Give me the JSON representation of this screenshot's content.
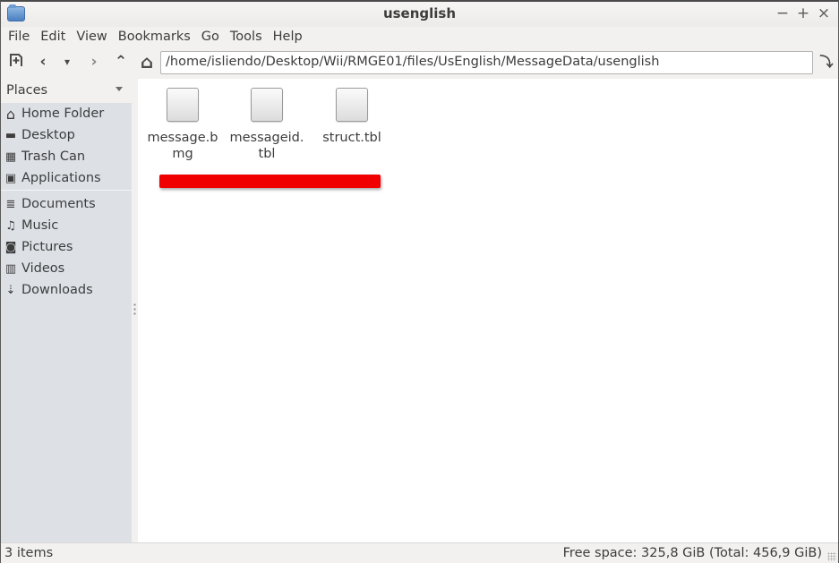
{
  "window": {
    "title": "usenglish",
    "controls": {
      "minimize": "−",
      "maximize": "+",
      "close": "×"
    }
  },
  "menubar": {
    "items": [
      "File",
      "Edit",
      "View",
      "Bookmarks",
      "Go",
      "Tools",
      "Help"
    ]
  },
  "toolbar": {
    "new_tab_icon": "new-tab-icon",
    "back_icon": "‹",
    "history_icon": "▾",
    "forward_icon": "›",
    "up_icon": "⌃",
    "home_icon": "⌂",
    "address": "/home/isliendo/Desktop/Wii/RMGE01/files/UsEnglish/MessageData/usenglish",
    "go_icon": "⤵"
  },
  "sidebar": {
    "header": "Places",
    "items": [
      {
        "label": "Home Folder",
        "icon": "home-icon",
        "glyph": "⌂"
      },
      {
        "label": "Desktop",
        "icon": "desktop-icon",
        "glyph": "▬"
      },
      {
        "label": "Trash Can",
        "icon": "trash-icon",
        "glyph": "▦"
      },
      {
        "label": "Applications",
        "icon": "applications-icon",
        "glyph": "▣"
      },
      {
        "label": "Documents",
        "icon": "documents-icon",
        "glyph": "≣"
      },
      {
        "label": "Music",
        "icon": "music-icon",
        "glyph": "♫"
      },
      {
        "label": "Pictures",
        "icon": "pictures-icon",
        "glyph": "◙"
      },
      {
        "label": "Videos",
        "icon": "videos-icon",
        "glyph": "▥"
      },
      {
        "label": "Downloads",
        "icon": "downloads-icon",
        "glyph": "⇣"
      }
    ]
  },
  "files": [
    {
      "name": "message.bmg"
    },
    {
      "name": "messageid.tbl"
    },
    {
      "name": "struct.tbl"
    }
  ],
  "statusbar": {
    "item_count": "3 items",
    "free_space": "Free space: 325,8 GiB (Total: 456,9 GiB)"
  },
  "colors": {
    "redaction": "#f00000",
    "sidebar_bg": "#dde1e6"
  }
}
